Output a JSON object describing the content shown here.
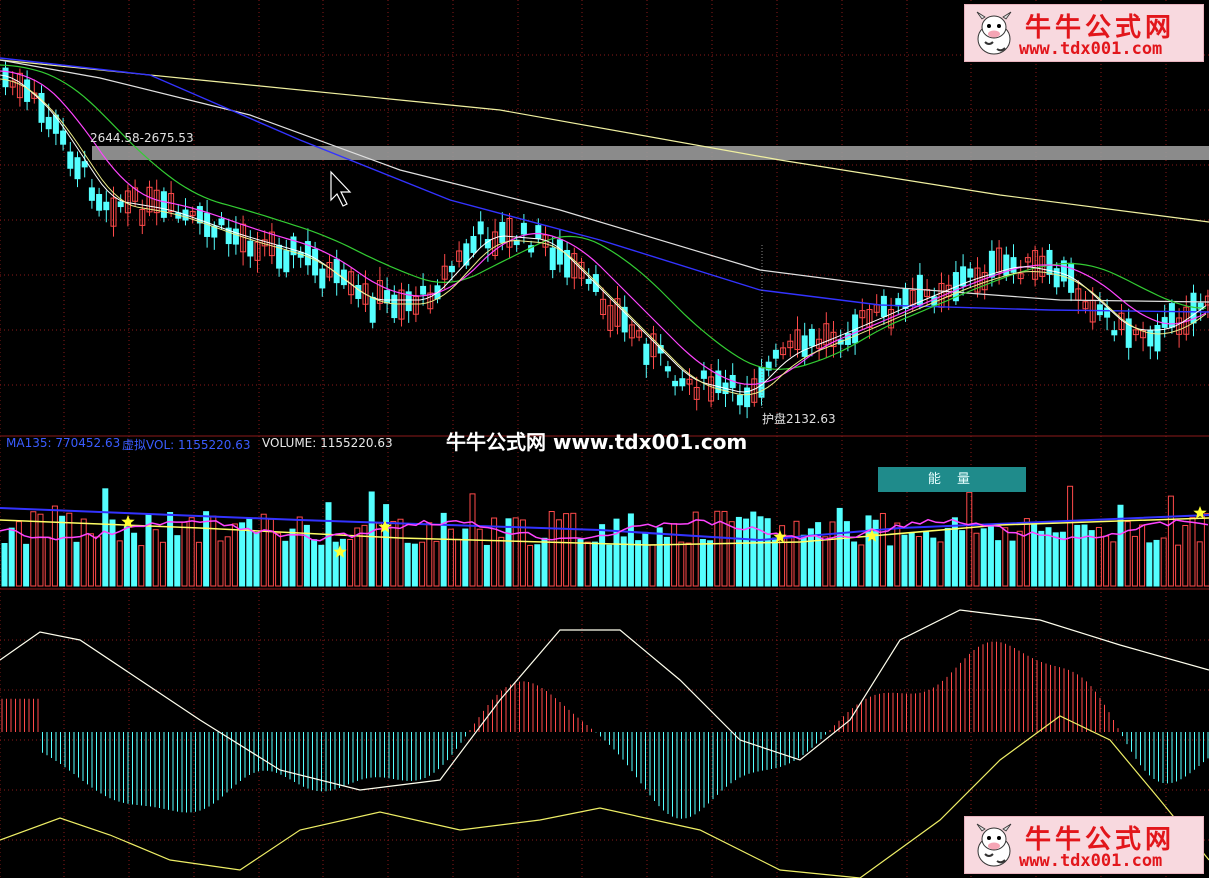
{
  "watermark": {
    "title": "牛牛公式网",
    "url": "www.tdx001.com",
    "center_text": "牛牛公式网 www.tdx001.com"
  },
  "price_panel": {
    "range_label": "2644.58-2675.53",
    "low_label": "2132.63",
    "low_prefix": "护盘"
  },
  "volume_panel": {
    "ma135_label": "MA135: 770452.63",
    "virtual_vol_label": "虚拟VOL: 1155220.63",
    "volume_label": "VOLUME: 1155220.63",
    "energy_button": "能 量"
  },
  "colors": {
    "background": "#000000",
    "grid": "#8b1a1a",
    "rise": "#ff4a4a",
    "fall": "#54ffff",
    "ma_white": "#ffffff",
    "ma_yellow": "#ffff66",
    "ma_magenta": "#ff44ff",
    "ma_green": "#33cc33",
    "ma_blue": "#3333ff",
    "ma135_text": "#3a5cff",
    "highlight_bar": "#9a9a9a"
  },
  "icons": [
    "cow-logo-icon",
    "cursor-arrow-icon",
    "star-icon"
  ]
}
